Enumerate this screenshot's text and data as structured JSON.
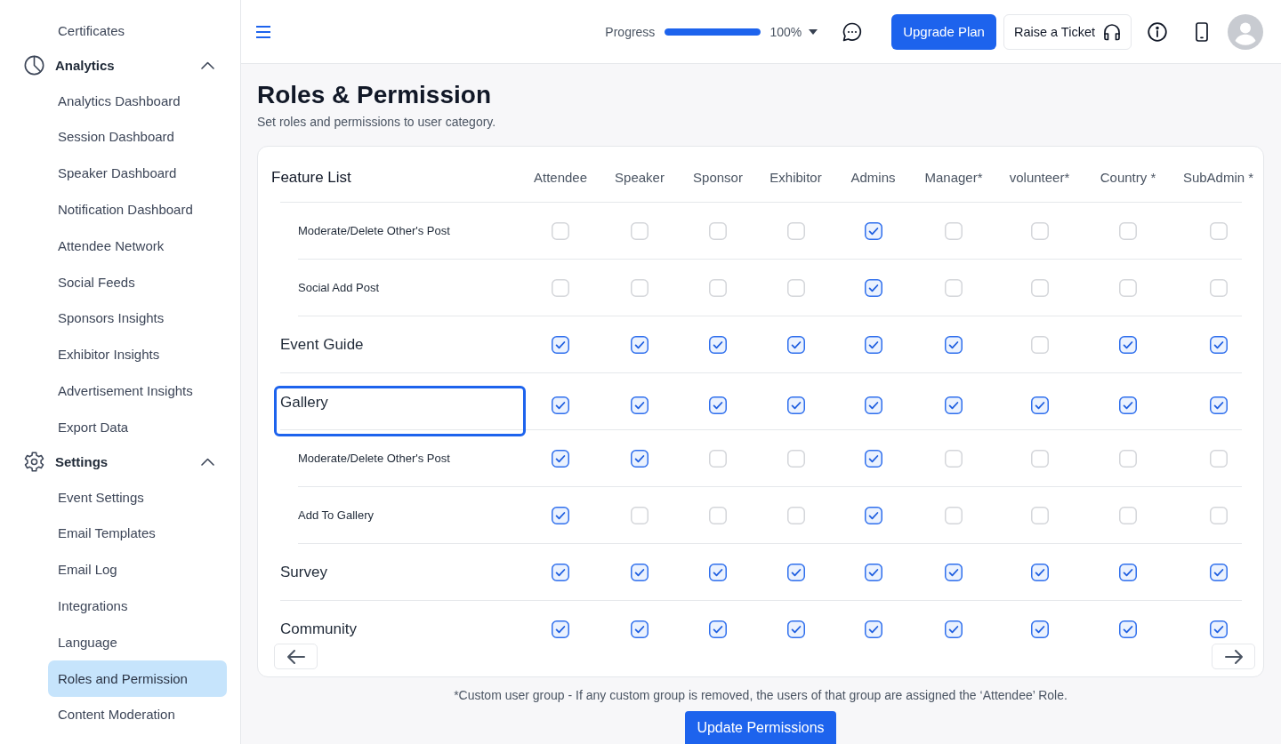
{
  "sidebar": {
    "items": [
      {
        "children": [
          {
            "label": "Certificates",
            "selected": false
          }
        ]
      },
      {
        "label": "Analytics",
        "expanded": true,
        "children": [
          {
            "label": "Analytics Dashboard",
            "selected": false
          },
          {
            "label": "Session Dashboard",
            "selected": false
          },
          {
            "label": "Speaker Dashboard",
            "selected": false
          },
          {
            "label": "Notification Dashboard",
            "selected": false
          },
          {
            "label": "Attendee Network",
            "selected": false
          },
          {
            "label": "Social Feeds",
            "selected": false
          },
          {
            "label": "Sponsors Insights",
            "selected": false
          },
          {
            "label": "Exhibitor Insights",
            "selected": false
          },
          {
            "label": "Advertisement Insights",
            "selected": false
          },
          {
            "label": "Export Data",
            "selected": false
          }
        ]
      },
      {
        "label": "Settings",
        "expanded": true,
        "children": [
          {
            "label": "Event Settings",
            "selected": false
          },
          {
            "label": "Email Templates",
            "selected": false
          },
          {
            "label": "Email Log",
            "selected": false
          },
          {
            "label": "Integrations",
            "selected": false
          },
          {
            "label": "Language",
            "selected": false
          },
          {
            "label": "Roles and Permission",
            "selected": true
          },
          {
            "label": "Content Moderation",
            "selected": false
          }
        ]
      }
    ]
  },
  "topbar": {
    "progress": {
      "label": "Progress",
      "level": 1,
      "reading": "100%"
    },
    "buttons": [
      {
        "kind": "primary",
        "label": "Upgrade Plan"
      },
      {
        "kind": "outline",
        "label": "Raise a Ticket"
      }
    ]
  },
  "page": {
    "title": "Roles & Permission",
    "subtitle": "Set roles and permissions to user category."
  },
  "table": {
    "header": "Feature List",
    "columns": [
      "Attendee",
      "Speaker",
      "Sponsor",
      "Exhibitor",
      "Admins",
      "Manager*",
      "volunteer*",
      "Country *",
      "SubAdmin *"
    ],
    "rows": [
      {
        "children": [
          {
            "label": "Moderate/Delete Other's Post",
            "focused": false,
            "cells": [
              {
                "checked": false
              },
              {
                "checked": false
              },
              {
                "checked": false
              },
              {
                "checked": false
              },
              {
                "checked": true
              },
              {
                "checked": false
              },
              {
                "checked": false
              },
              {
                "checked": false
              },
              {
                "checked": false
              }
            ]
          },
          {
            "label": "Social Add Post",
            "focused": false,
            "cells": [
              {
                "checked": false
              },
              {
                "checked": false
              },
              {
                "checked": false
              },
              {
                "checked": false
              },
              {
                "checked": true
              },
              {
                "checked": false
              },
              {
                "checked": false
              },
              {
                "checked": false
              },
              {
                "checked": false
              }
            ]
          }
        ]
      },
      {
        "label": "Event Guide",
        "focused": false,
        "cells": [
          {
            "checked": true
          },
          {
            "checked": true
          },
          {
            "checked": true
          },
          {
            "checked": true
          },
          {
            "checked": true
          },
          {
            "checked": true
          },
          {
            "checked": false
          },
          {
            "checked": true
          },
          {
            "checked": true
          }
        ]
      },
      {
        "label": "Gallery",
        "focused": true,
        "cells": [
          {
            "checked": true
          },
          {
            "checked": true
          },
          {
            "checked": true
          },
          {
            "checked": true
          },
          {
            "checked": true
          },
          {
            "checked": true
          },
          {
            "checked": true
          },
          {
            "checked": true
          },
          {
            "checked": true
          }
        ],
        "children": [
          {
            "label": "Moderate/Delete Other's Post",
            "focused": false,
            "cells": [
              {
                "checked": true
              },
              {
                "checked": true
              },
              {
                "checked": false
              },
              {
                "checked": false
              },
              {
                "checked": true
              },
              {
                "checked": false
              },
              {
                "checked": false
              },
              {
                "checked": false
              },
              {
                "checked": false
              }
            ]
          },
          {
            "label": "Add To Gallery",
            "focused": false,
            "cells": [
              {
                "checked": true
              },
              {
                "checked": false
              },
              {
                "checked": false
              },
              {
                "checked": false
              },
              {
                "checked": true
              },
              {
                "checked": false
              },
              {
                "checked": false
              },
              {
                "checked": false
              },
              {
                "checked": false
              }
            ]
          }
        ]
      },
      {
        "label": "Survey",
        "focused": false,
        "cells": [
          {
            "checked": true
          },
          {
            "checked": true
          },
          {
            "checked": true
          },
          {
            "checked": true
          },
          {
            "checked": true
          },
          {
            "checked": true
          },
          {
            "checked": true
          },
          {
            "checked": true
          },
          {
            "checked": true
          }
        ]
      },
      {
        "label": "Community",
        "focused": false,
        "cells": [
          {
            "checked": true
          },
          {
            "checked": true
          },
          {
            "checked": true
          },
          {
            "checked": true
          },
          {
            "checked": true
          },
          {
            "checked": true
          },
          {
            "checked": true
          },
          {
            "checked": true
          },
          {
            "checked": true
          }
        ]
      }
    ]
  },
  "footnote": "*Custom user group - If any custom group is removed, the users of that group are assigned the ‘Attendee’ Role.",
  "submit": {
    "label": "Update Permissions"
  }
}
